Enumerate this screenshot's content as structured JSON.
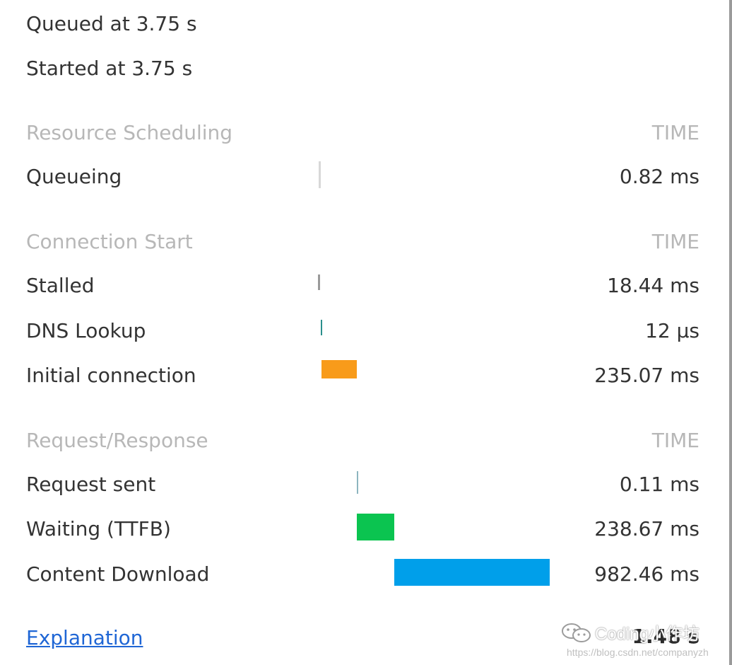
{
  "summary": {
    "queued": "Queued at 3.75 s",
    "started": "Started at 3.75 s"
  },
  "sections": {
    "resource_scheduling": {
      "title": "Resource Scheduling",
      "time_label": "TIME"
    },
    "connection_start": {
      "title": "Connection Start",
      "time_label": "TIME"
    },
    "request_response": {
      "title": "Request/Response",
      "time_label": "TIME"
    }
  },
  "rows": {
    "queueing": {
      "label": "Queueing",
      "duration": "0.82 ms",
      "color": "#d8d8d8"
    },
    "stalled": {
      "label": "Stalled",
      "duration": "18.44 ms",
      "color": "#9a9a9a"
    },
    "dns_lookup": {
      "label": "DNS Lookup",
      "duration": "12 μs",
      "color": "#2b8f8d"
    },
    "initial_connection": {
      "label": "Initial connection",
      "duration": "235.07 ms",
      "color": "#f89b1a"
    },
    "request_sent": {
      "label": "Request sent",
      "duration": "0.11 ms",
      "color": "#8db5bf"
    },
    "waiting": {
      "label": "Waiting (TTFB)",
      "duration": "238.67 ms",
      "color": "#0bc450"
    },
    "content_download": {
      "label": "Content Download",
      "duration": "982.46 ms",
      "color": "#009fea"
    }
  },
  "footer": {
    "explanation": "Explanation",
    "total": "1.48 s"
  },
  "watermark": {
    "brand": "Coding小作坊",
    "url": "https://blog.csdn.net/companyzh",
    "icon": "wechat-icon"
  }
}
